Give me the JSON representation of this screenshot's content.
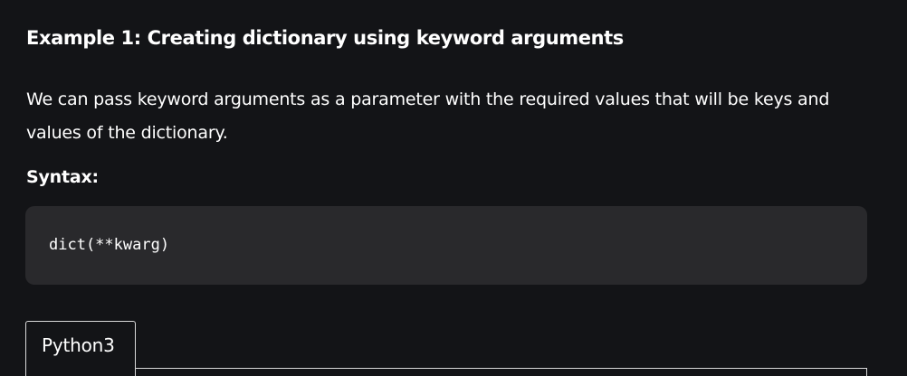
{
  "article": {
    "heading": "Example 1: Creating dictionary using keyword arguments",
    "paragraph": "We can pass keyword arguments as a parameter with the required values that will be keys and values of the dictionary.",
    "syntax_label": "Syntax:",
    "code": "dict(**kwarg)"
  },
  "tabs": [
    {
      "label": "Python3",
      "active": true
    }
  ],
  "colors": {
    "background": "#131417",
    "code_background": "#29292c",
    "text": "#ffffff",
    "tab_border": "#d9d9d9"
  }
}
